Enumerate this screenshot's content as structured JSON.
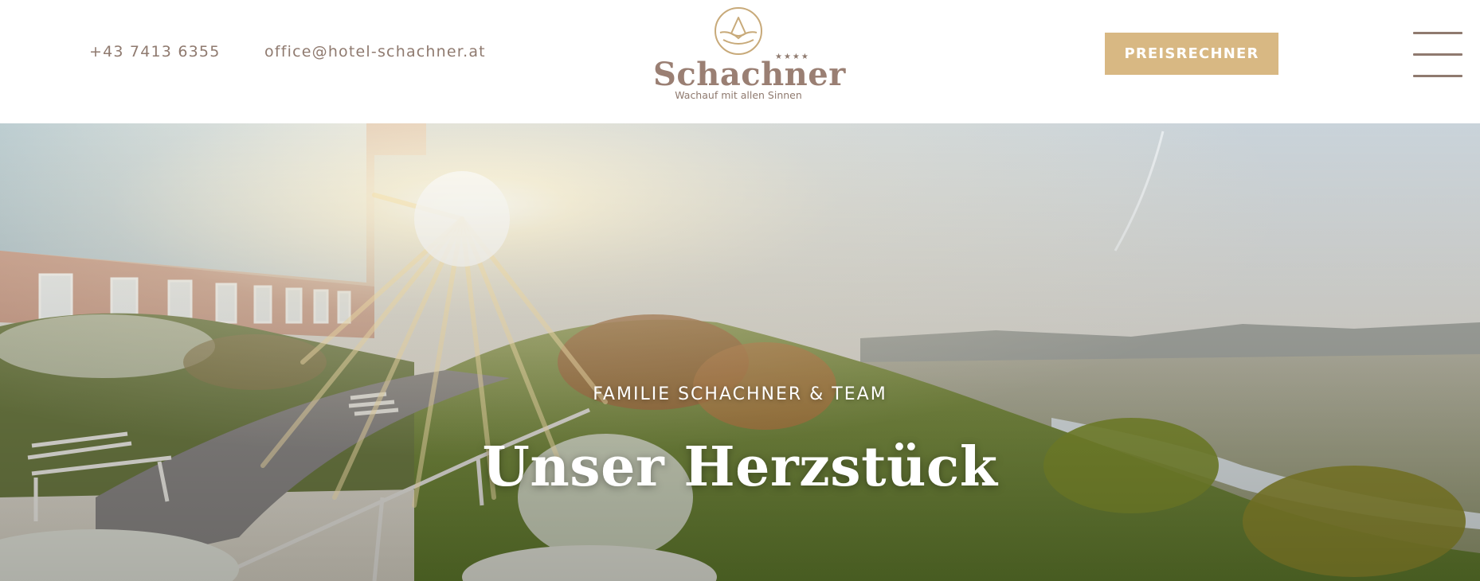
{
  "header": {
    "phone": "+43 7413 6355",
    "email": "office@hotel-schachner.at",
    "logo": {
      "name": "Schachner",
      "stars": "★★★★",
      "tagline": "Wachauf mit allen Sinnen"
    },
    "cta_label": "PREISRECHNER",
    "menu_icon": "hamburger-icon"
  },
  "hero": {
    "kicker": "FAMILIE SCHACHNER & TEAM",
    "title": "Unser Herzstück"
  },
  "colors": {
    "brand_text": "#8f7a6f",
    "accent": "#d8b883",
    "background": "#ffffff"
  }
}
